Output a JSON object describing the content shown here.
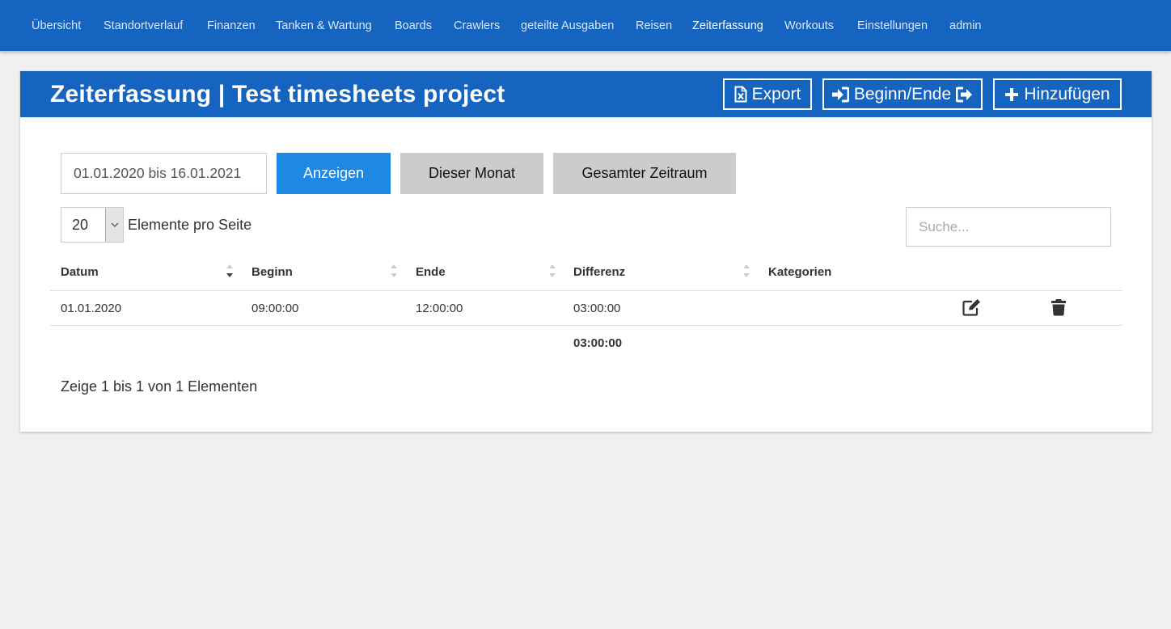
{
  "nav": {
    "items": [
      {
        "label": "Übersicht"
      },
      {
        "label": "Standortverlauf"
      },
      {
        "label": "Finanzen"
      },
      {
        "label": "Tanken & Wartung"
      },
      {
        "label": "Boards"
      },
      {
        "label": "Crawlers"
      },
      {
        "label": "geteilte Ausgaben"
      },
      {
        "label": "Reisen"
      },
      {
        "label": "Zeiterfassung",
        "active": true
      },
      {
        "label": "Workouts"
      },
      {
        "label": "Einstellungen"
      },
      {
        "label": "admin"
      }
    ]
  },
  "header": {
    "title": "Zeiterfassung | Test timesheets project",
    "export_label": "Export",
    "export_icon": "file-excel-icon",
    "checkin_label": "Beginn/Ende",
    "checkin_icon_left": "sign-in-icon",
    "checkin_icon_right": "sign-out-icon",
    "add_label": "Hinzufügen",
    "add_icon": "plus-icon"
  },
  "filter": {
    "date_range": "01.01.2020 bis 16.01.2021",
    "show_label": "Anzeigen",
    "this_month_label": "Dieser Monat",
    "all_time_label": "Gesamter Zeitraum"
  },
  "table_controls": {
    "page_size": "20",
    "page_size_label": "Elemente pro Seite",
    "search_placeholder": "Suche..."
  },
  "table": {
    "columns": [
      "Datum",
      "Beginn",
      "Ende",
      "Differenz",
      "Kategorien"
    ],
    "rows": [
      {
        "datum": "01.01.2020",
        "beginn": "09:00:00",
        "ende": "12:00:00",
        "differenz": "03:00:00",
        "kategorien": ""
      }
    ],
    "total": "03:00:00",
    "edit_icon": "edit-icon",
    "delete_icon": "trash-icon"
  },
  "info": "Zeige 1 bis 1 von 1 Elementen",
  "colors": {
    "brand_blue": "#1565c0",
    "button_blue": "#1e88e5",
    "button_grey": "#cccccc",
    "background": "#f0f0f0"
  }
}
